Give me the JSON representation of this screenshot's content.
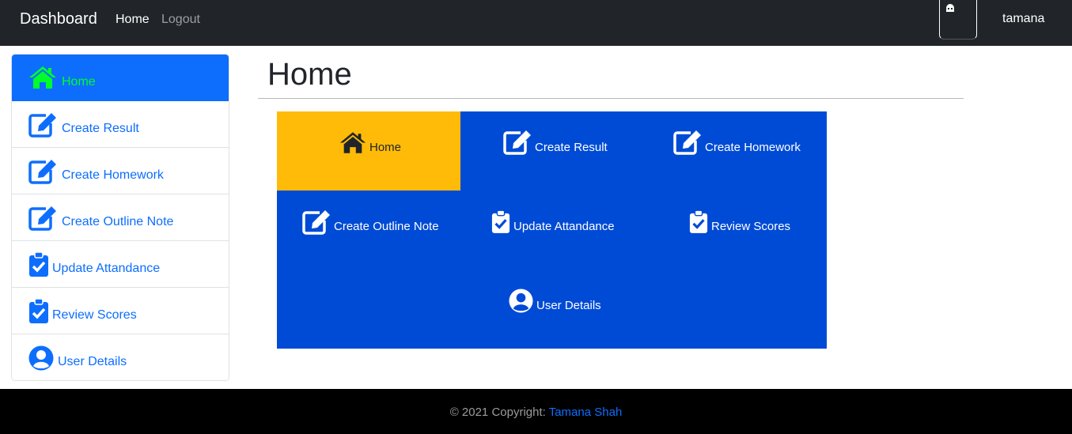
{
  "navbar": {
    "brand": "Dashboard",
    "links": [
      "Home",
      "Logout"
    ],
    "username": "tamana"
  },
  "sidebar": {
    "items": [
      {
        "label": "Home",
        "icon": "home-icon",
        "active": true
      },
      {
        "label": "Create Result",
        "icon": "edit-icon",
        "active": false
      },
      {
        "label": "Create Homework",
        "icon": "edit-icon",
        "active": false
      },
      {
        "label": "Create Outline Note",
        "icon": "edit-icon",
        "active": false
      },
      {
        "label": "Update Attandance",
        "icon": "clipboard-check-icon",
        "active": false
      },
      {
        "label": "Review Scores",
        "icon": "clipboard-check-icon",
        "active": false
      },
      {
        "label": "User Details",
        "icon": "user-circle-icon",
        "active": false
      }
    ]
  },
  "main": {
    "title": "Home",
    "tiles": [
      {
        "label": "Home",
        "icon": "home-icon"
      },
      {
        "label": "Create Result",
        "icon": "edit-icon"
      },
      {
        "label": "Create Homework",
        "icon": "edit-icon"
      },
      {
        "label": "Create Outline Note",
        "icon": "edit-icon"
      },
      {
        "label": "Update Attandance",
        "icon": "clipboard-check-icon"
      },
      {
        "label": "Review Scores",
        "icon": "clipboard-check-icon"
      },
      {
        "label": "User Details",
        "icon": "user-circle-icon"
      }
    ]
  },
  "footer": {
    "prefix": "© 2021 Copyright:",
    "author": "Tamana Shah"
  },
  "colors": {
    "navbar": "#212529",
    "primary": "#0d6efd",
    "active_text": "#00ff2a",
    "tile_bg": "#004bd6",
    "tile_highlight": "#ffbb07",
    "footer": "#000000"
  }
}
